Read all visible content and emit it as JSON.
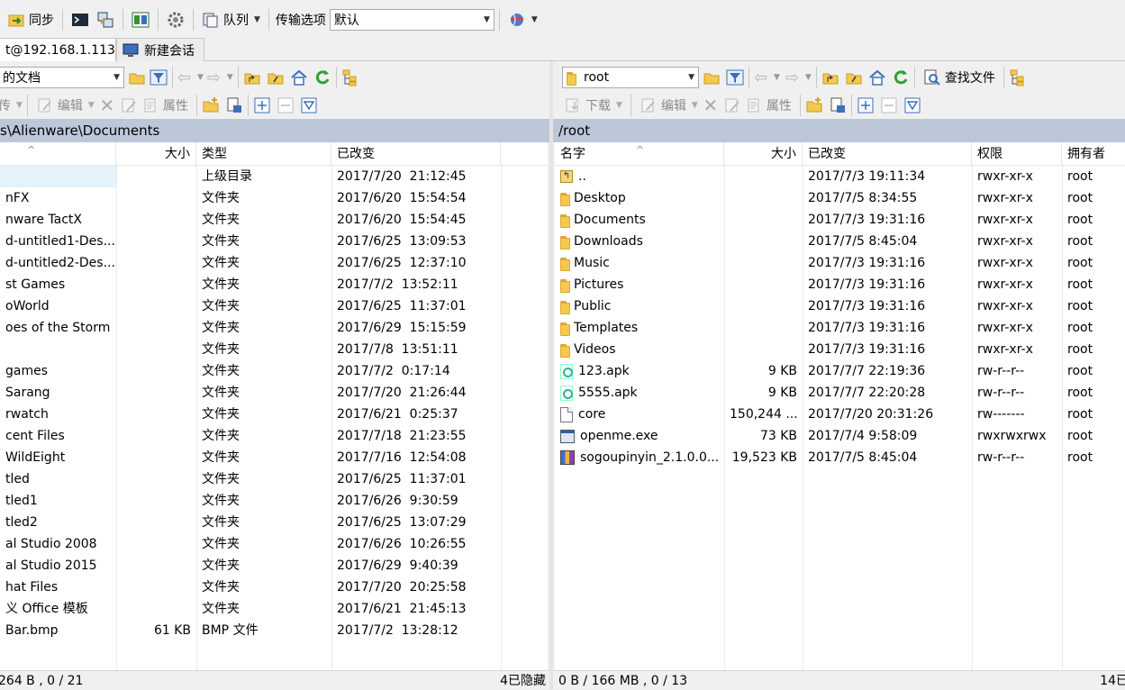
{
  "toolbar": {
    "sync_label": "同步",
    "queue_label": "队列",
    "transfer_options_label": "传输选项",
    "transfer_options_value": "默认"
  },
  "tabs": [
    {
      "label": "t@192.168.1.113"
    },
    {
      "label": "新建会话"
    }
  ],
  "left": {
    "location_value": "的文档",
    "actions": {
      "upload": "传",
      "edit": "编辑",
      "properties": "属性"
    },
    "path": "s\\Alienware\\Documents",
    "columns": {
      "size": "大小",
      "type": "类型",
      "changed": "已改变"
    },
    "rows": [
      {
        "name": "",
        "size": "",
        "type": "上级目录",
        "changed": "2017/7/20  21:12:45"
      },
      {
        "name": "nFX",
        "size": "",
        "type": "文件夹",
        "changed": "2017/6/20  15:54:54"
      },
      {
        "name": "nware TactX",
        "size": "",
        "type": "文件夹",
        "changed": "2017/6/20  15:54:45"
      },
      {
        "name": "d-untitled1-Des...",
        "size": "",
        "type": "文件夹",
        "changed": "2017/6/25  13:09:53"
      },
      {
        "name": "d-untitled2-Des...",
        "size": "",
        "type": "文件夹",
        "changed": "2017/6/25  12:37:10"
      },
      {
        "name": "st Games",
        "size": "",
        "type": "文件夹",
        "changed": "2017/7/2  13:52:11"
      },
      {
        "name": "oWorld",
        "size": "",
        "type": "文件夹",
        "changed": "2017/6/25  11:37:01"
      },
      {
        "name": "oes of the Storm",
        "size": "",
        "type": "文件夹",
        "changed": "2017/6/29  15:15:59"
      },
      {
        "name": "",
        "size": "",
        "type": "文件夹",
        "changed": "2017/7/8  13:51:11"
      },
      {
        "name": "games",
        "size": "",
        "type": "文件夹",
        "changed": "2017/7/2  0:17:14"
      },
      {
        "name": "Sarang",
        "size": "",
        "type": "文件夹",
        "changed": "2017/7/20  21:26:44"
      },
      {
        "name": "rwatch",
        "size": "",
        "type": "文件夹",
        "changed": "2017/6/21  0:25:37"
      },
      {
        "name": "cent Files",
        "size": "",
        "type": "文件夹",
        "changed": "2017/7/18  21:23:55"
      },
      {
        "name": "WildEight",
        "size": "",
        "type": "文件夹",
        "changed": "2017/7/16  12:54:08"
      },
      {
        "name": "tled",
        "size": "",
        "type": "文件夹",
        "changed": "2017/6/25  11:37:01"
      },
      {
        "name": "tled1",
        "size": "",
        "type": "文件夹",
        "changed": "2017/6/26  9:30:59"
      },
      {
        "name": "tled2",
        "size": "",
        "type": "文件夹",
        "changed": "2017/6/25  13:07:29"
      },
      {
        "name": "al Studio 2008",
        "size": "",
        "type": "文件夹",
        "changed": "2017/6/26  10:26:55"
      },
      {
        "name": "al Studio 2015",
        "size": "",
        "type": "文件夹",
        "changed": "2017/6/29  9:40:39"
      },
      {
        "name": "hat Files",
        "size": "",
        "type": "文件夹",
        "changed": "2017/7/20  20:25:58"
      },
      {
        "name": "义 Office 模板",
        "size": "",
        "type": "文件夹",
        "changed": "2017/6/21  21:45:13"
      },
      {
        "name": "Bar.bmp",
        "size": "61 KB",
        "type": "BMP 文件",
        "changed": "2017/7/2  13:28:12"
      }
    ],
    "status_left": "264 B , 0 / 21",
    "status_right": "4已隐藏"
  },
  "right": {
    "location_value": "root",
    "find_files_label": "查找文件",
    "actions": {
      "download": "下载",
      "edit": "编辑",
      "properties": "属性"
    },
    "path": "/root",
    "columns": {
      "name": "名字",
      "size": "大小",
      "changed": "已改变",
      "rights": "权限",
      "owner": "拥有者"
    },
    "rows": [
      {
        "icon": "up",
        "name": "..",
        "size": "",
        "changed": "2017/7/3 19:11:34",
        "rights": "rwxr-xr-x",
        "owner": "root"
      },
      {
        "icon": "folder",
        "name": "Desktop",
        "size": "",
        "changed": "2017/7/5 8:34:55",
        "rights": "rwxr-xr-x",
        "owner": "root"
      },
      {
        "icon": "folder",
        "name": "Documents",
        "size": "",
        "changed": "2017/7/3 19:31:16",
        "rights": "rwxr-xr-x",
        "owner": "root"
      },
      {
        "icon": "folder",
        "name": "Downloads",
        "size": "",
        "changed": "2017/7/5 8:45:04",
        "rights": "rwxr-xr-x",
        "owner": "root"
      },
      {
        "icon": "folder",
        "name": "Music",
        "size": "",
        "changed": "2017/7/3 19:31:16",
        "rights": "rwxr-xr-x",
        "owner": "root"
      },
      {
        "icon": "folder",
        "name": "Pictures",
        "size": "",
        "changed": "2017/7/3 19:31:16",
        "rights": "rwxr-xr-x",
        "owner": "root"
      },
      {
        "icon": "folder",
        "name": "Public",
        "size": "",
        "changed": "2017/7/3 19:31:16",
        "rights": "rwxr-xr-x",
        "owner": "root"
      },
      {
        "icon": "folder",
        "name": "Templates",
        "size": "",
        "changed": "2017/7/3 19:31:16",
        "rights": "rwxr-xr-x",
        "owner": "root"
      },
      {
        "icon": "folder",
        "name": "Videos",
        "size": "",
        "changed": "2017/7/3 19:31:16",
        "rights": "rwxr-xr-x",
        "owner": "root"
      },
      {
        "icon": "apk",
        "name": "123.apk",
        "size": "9 KB",
        "changed": "2017/7/7 22:19:36",
        "rights": "rw-r--r--",
        "owner": "root"
      },
      {
        "icon": "apk",
        "name": "5555.apk",
        "size": "9 KB",
        "changed": "2017/7/7 22:20:28",
        "rights": "rw-r--r--",
        "owner": "root"
      },
      {
        "icon": "file",
        "name": "core",
        "size": "150,244 ...",
        "changed": "2017/7/20 20:31:26",
        "rights": "rw-------",
        "owner": "root"
      },
      {
        "icon": "exe",
        "name": "openme.exe",
        "size": "73 KB",
        "changed": "2017/7/4 9:58:09",
        "rights": "rwxrwxrwx",
        "owner": "root"
      },
      {
        "icon": "zip",
        "name": "sogoupinyin_2.1.0.0...",
        "size": "19,523 KB",
        "changed": "2017/7/5 8:45:04",
        "rights": "rw-r--r--",
        "owner": "root"
      }
    ],
    "status_left": "0 B / 166 MB , 0 / 13",
    "status_right": "14已"
  },
  "colors": {
    "path_bar": "#bcc8d8",
    "folder": "#f4c94d",
    "selection": "#e5f1fb"
  }
}
